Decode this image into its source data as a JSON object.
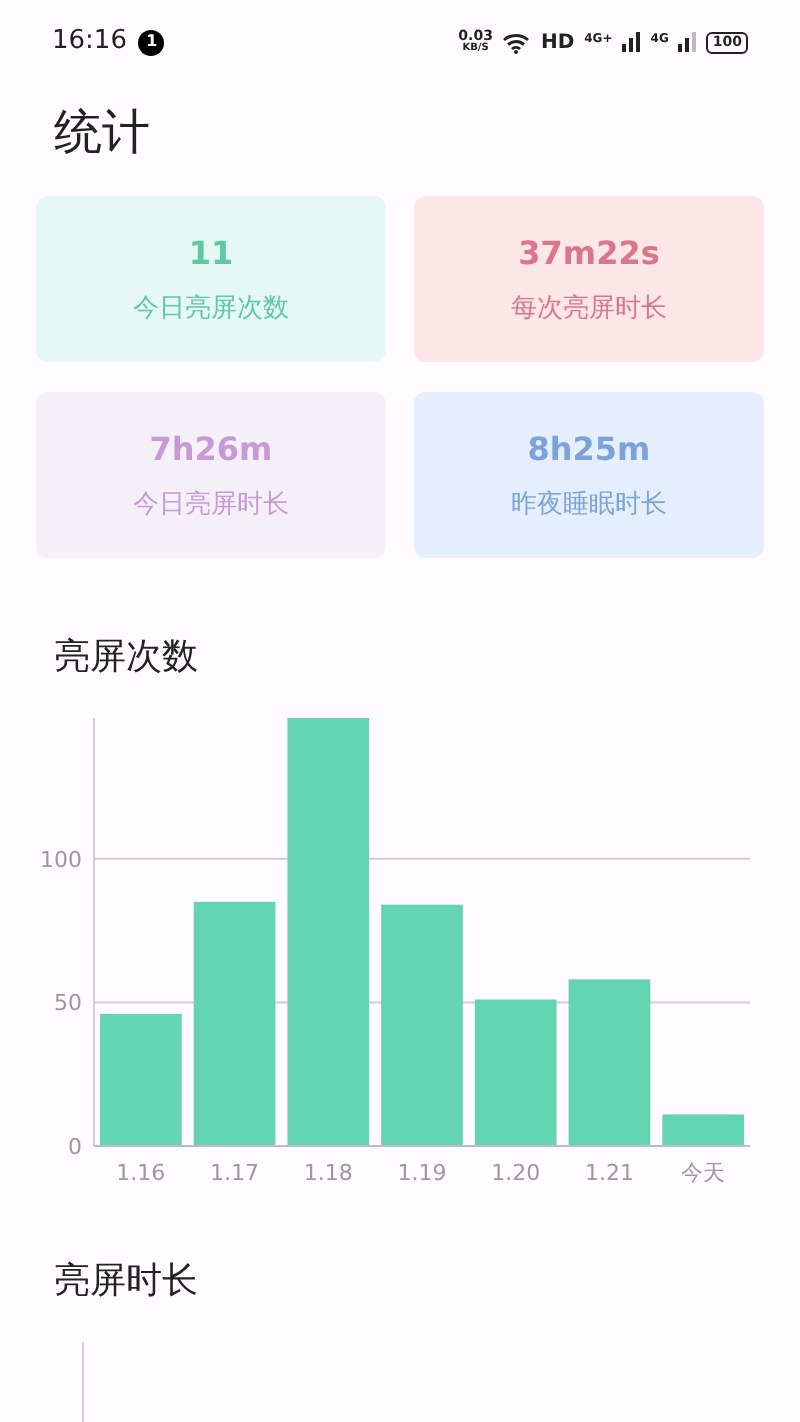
{
  "status_bar": {
    "time": "16:16",
    "notification_count": "1",
    "net_speed": "0.03",
    "net_unit": "KB/S",
    "hd": "HD",
    "signal_1": "4G+",
    "signal_2": "4G",
    "battery": "100"
  },
  "title": "统计",
  "stats": [
    {
      "value": "11",
      "label": "今日亮屏次数",
      "color": "#5ec7a3"
    },
    {
      "value": "37m22s",
      "label": "每次亮屏时长",
      "color": "#d9768a"
    },
    {
      "value": "7h26m",
      "label": "今日亮屏时长",
      "color": "#c69ad4"
    },
    {
      "value": "8h25m",
      "label": "昨夜睡眠时长",
      "color": "#7ba3d9"
    }
  ],
  "sections": [
    {
      "title": "亮屏次数",
      "chart_data": {
        "type": "bar",
        "categories": [
          "1.16",
          "1.17",
          "1.18",
          "1.19",
          "1.20",
          "1.21",
          "今天"
        ],
        "series": [
          {
            "color": "#63d5b1",
            "values": [
              46,
              85,
              149,
              84,
              51,
              58,
              11
            ]
          }
        ],
        "ylim": [
          0,
          149
        ],
        "yticks": [
          0,
          50,
          100
        ]
      }
    },
    {
      "title": "亮屏时长"
    }
  ]
}
